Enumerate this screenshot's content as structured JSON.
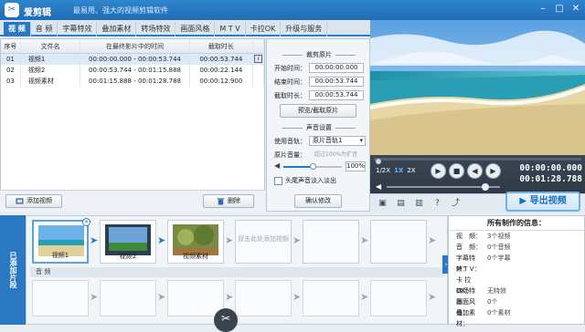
{
  "app": {
    "name": "爱剪辑",
    "slogan": "最易用、强大的视频剪辑软件"
  },
  "tabs": [
    "视 频",
    "音 频",
    "字幕特效",
    "叠加素材",
    "转场特效",
    "画面风格",
    "M T V",
    "卡拉OK",
    "升级与服务"
  ],
  "clip_list": {
    "headers": [
      "序号",
      "文件名",
      "在最终影片中的时间",
      "截取时长"
    ],
    "rows": [
      {
        "no": "01",
        "name": "视频1",
        "span": "00:00:00.000 - 00:00:53.744",
        "dur": "00:00:53.744"
      },
      {
        "no": "02",
        "name": "视频2",
        "span": "00:00:53.744 - 00:01:15.888",
        "dur": "00:00:22.144"
      },
      {
        "no": "03",
        "name": "视频素材",
        "span": "00:01:15.888 - 00:01:28.788",
        "dur": "00:00:12.900"
      }
    ],
    "info_glyph": "i",
    "add_label": "添加视频",
    "delete_label": "删除"
  },
  "edit": {
    "trim_title": "裁剪原片",
    "start_label": "开始时间：",
    "start": "00:00:00.000",
    "end_label": "结束时间：",
    "end": "00:00:53.744",
    "dur_label": "截取时长：",
    "dur": "00:00:53.744",
    "preview_trim": "预览/截取原片",
    "audio_title": "声音设置",
    "track_label": "使用音轨：",
    "track": "原片音轨1",
    "volume_label": "原片音量：",
    "volume_hint": "超过100%为扩音",
    "volume_value": "100%",
    "volume_level": 1.0,
    "fade_label": "头尾声音淡入淡出",
    "confirm": "确认修改"
  },
  "player": {
    "speeds": [
      "1/2X",
      "1X",
      "2X"
    ],
    "active_speed": "1X",
    "current_time": "00:00:00.000",
    "total_time": "00:01:28.788",
    "export": "导出视频"
  },
  "storyboard": {
    "side_label": "已添加片段",
    "clips": [
      "视频1",
      "视频2",
      "视频素材"
    ],
    "add_hint": "双击此处添加视频",
    "audio_label": "音 频"
  },
  "summary": {
    "title": "所有制作的信息：",
    "rows": [
      {
        "k": "视　频：",
        "v": "3个视频"
      },
      {
        "k": "音　频：",
        "v": "0个音频"
      },
      {
        "k": "字幕特效：",
        "v": "0个字幕"
      },
      {
        "k": "M T V：",
        "v": ""
      },
      {
        "k": "卡 拉 OK：",
        "v": ""
      },
      {
        "k": "转场特效：",
        "v": "无特效"
      },
      {
        "k": "画面风格：",
        "v": "0个"
      },
      {
        "k": "叠加素材：",
        "v": "0个素材"
      }
    ]
  },
  "colors": {
    "accent": "#2a78c2",
    "titlebar": "#1f6cb4"
  }
}
